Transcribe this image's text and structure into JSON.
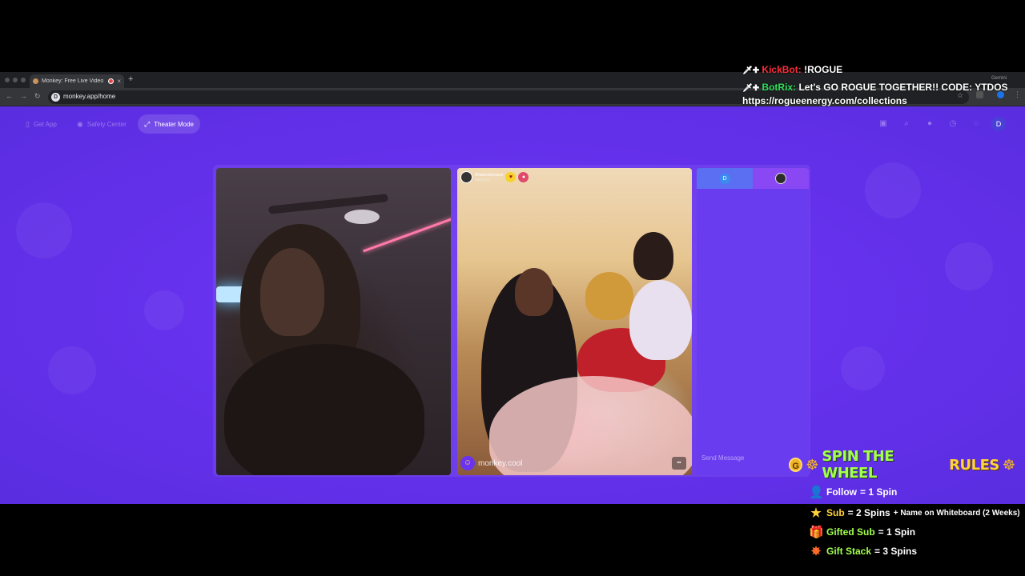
{
  "browser": {
    "tab_title": "Monkey: Free Live Video Chat",
    "tab_close": "×",
    "new_tab": "+",
    "url": "monkey.app/home",
    "site_icon": "D",
    "profile_label": "Gemini"
  },
  "nav": {
    "get_app": "Get App",
    "safety_center": "Safety Center",
    "theater_mode": "Theater Mode",
    "user_initial": "D"
  },
  "video_right": {
    "username": "Ariahxmonaee",
    "location": "Maryland",
    "brand": "monkey.cool"
  },
  "chat": {
    "tab_a_initial": "D",
    "placeholder": "Send Message"
  },
  "stream_chat": [
    {
      "user": "KickBot:",
      "message": "!ROGUE"
    },
    {
      "user": "BotRix:",
      "message": "Let's GO ROGUE TOGETHER!! CODE: YTDOS"
    },
    {
      "user": "",
      "message": "https://rogueenergy.com/collections"
    }
  ],
  "wheel": {
    "title_a": "SPIN THE WHEEL",
    "title_b": "RULES",
    "rules": [
      {
        "key": "Follow",
        "value": "= 1 Spin",
        "extra": ""
      },
      {
        "key": "Sub",
        "value": "= 2 Spins",
        "extra": "+ Name on Whiteboard (2 Weeks)"
      },
      {
        "key": "Gifted Sub",
        "value": "= 1 Spin",
        "extra": ""
      },
      {
        "key": "Gift Stack",
        "value": "= 3 Spins",
        "extra": ""
      }
    ]
  },
  "colors": {
    "page_bg": "#6a33f0",
    "spin_green": "#a3ff4d",
    "rules_yellow": "#ffd23a",
    "kickbot_red": "#ff2e3a",
    "botrix_green": "#2fe05a"
  }
}
